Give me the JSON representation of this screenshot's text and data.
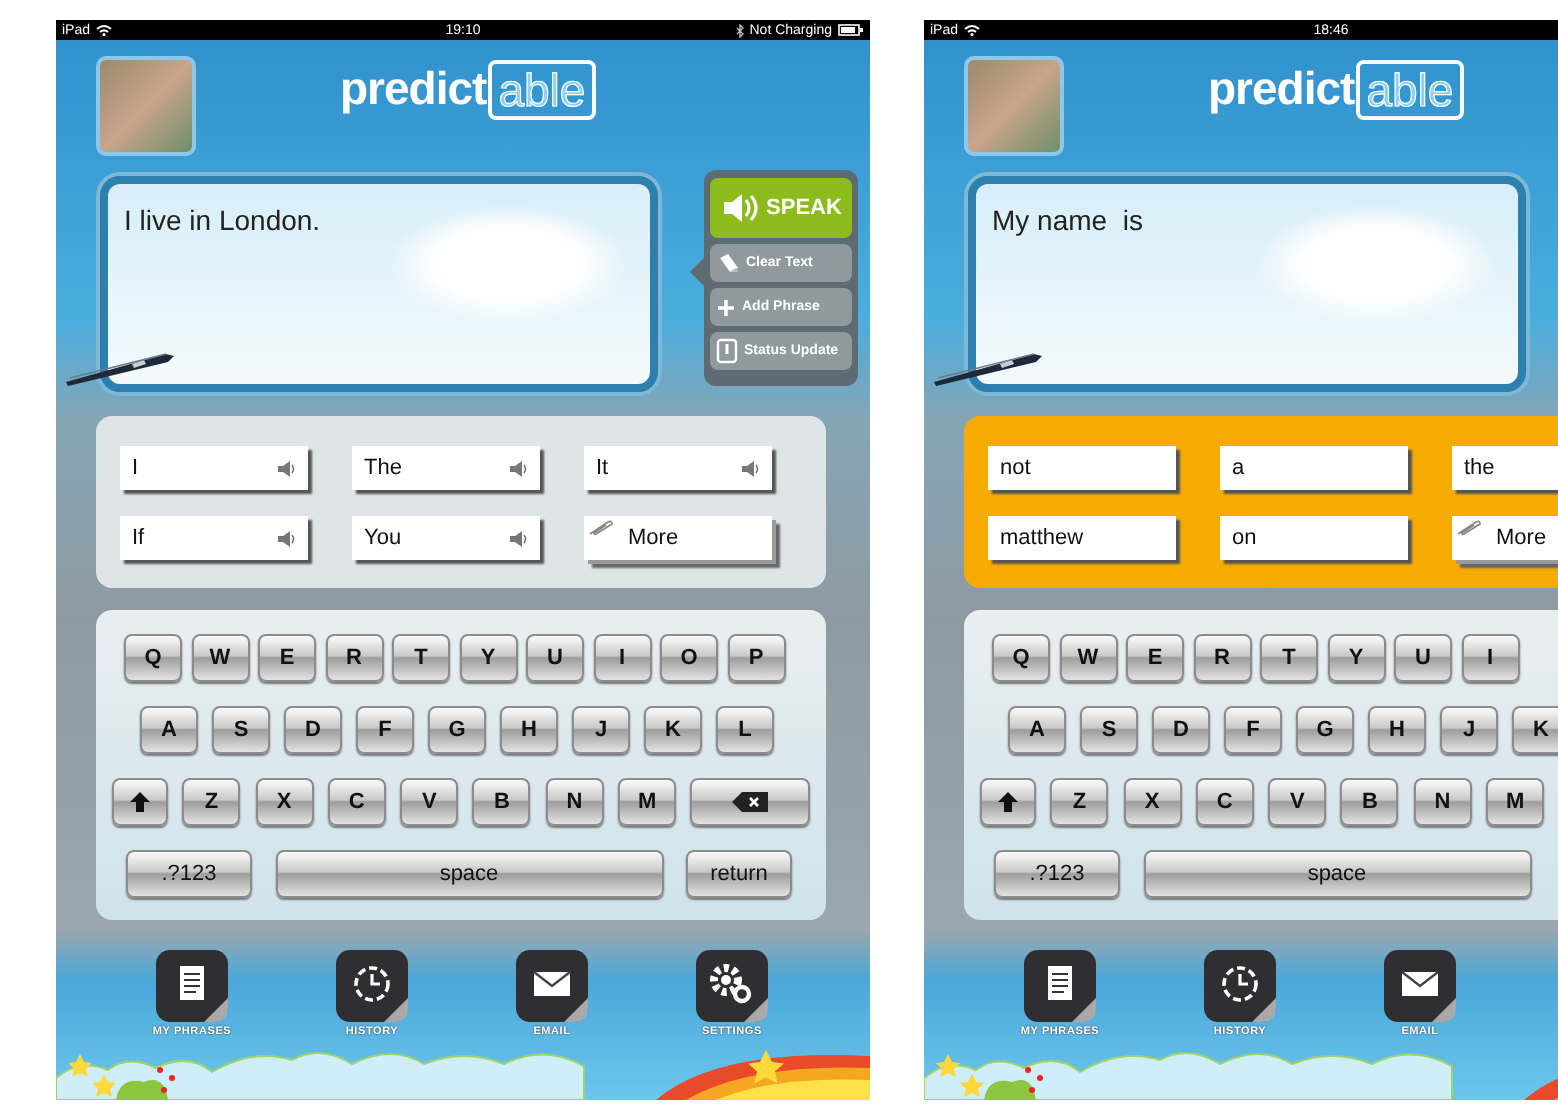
{
  "screens": [
    {
      "status_bar": {
        "carrier": "iPad",
        "time": "19:10",
        "charging": "Not Charging"
      },
      "logo": {
        "main": "predict",
        "accent": "able"
      },
      "message": "I live in London.",
      "actions": [
        {
          "kind": "speak",
          "label": "SPEAK"
        },
        {
          "kind": "clear",
          "label": "Clear Text"
        },
        {
          "kind": "add",
          "label": "Add Phrase"
        },
        {
          "kind": "status",
          "label": "Status Update"
        }
      ],
      "word_panel": {
        "highlighted": false,
        "words": [
          {
            "kind": "word",
            "text": "I",
            "speaker": true
          },
          {
            "kind": "word",
            "text": "The",
            "speaker": true
          },
          {
            "kind": "word",
            "text": "It",
            "speaker": true
          },
          {
            "kind": "word",
            "text": "If",
            "speaker": true
          },
          {
            "kind": "word",
            "text": "You",
            "speaker": true
          },
          {
            "kind": "more",
            "text": "More"
          }
        ]
      },
      "keyboard": [
        [
          {
            "kind": "letter",
            "label": "Q"
          },
          {
            "kind": "letter",
            "label": "W"
          },
          {
            "kind": "letter",
            "label": "E"
          },
          {
            "kind": "letter",
            "label": "R"
          },
          {
            "kind": "letter",
            "label": "T"
          },
          {
            "kind": "letter",
            "label": "Y"
          },
          {
            "kind": "letter",
            "label": "U"
          },
          {
            "kind": "letter",
            "label": "I"
          },
          {
            "kind": "letter",
            "label": "O"
          },
          {
            "kind": "letter",
            "label": "P"
          }
        ],
        [
          {
            "kind": "letter",
            "label": "A"
          },
          {
            "kind": "letter",
            "label": "S"
          },
          {
            "kind": "letter",
            "label": "D"
          },
          {
            "kind": "letter",
            "label": "F"
          },
          {
            "kind": "letter",
            "label": "G"
          },
          {
            "kind": "letter",
            "label": "H"
          },
          {
            "kind": "letter",
            "label": "J"
          },
          {
            "kind": "letter",
            "label": "K"
          },
          {
            "kind": "letter",
            "label": "L"
          }
        ],
        [
          {
            "kind": "shift"
          },
          {
            "kind": "letter",
            "label": "Z"
          },
          {
            "kind": "letter",
            "label": "X"
          },
          {
            "kind": "letter",
            "label": "C"
          },
          {
            "kind": "letter",
            "label": "V"
          },
          {
            "kind": "letter",
            "label": "B"
          },
          {
            "kind": "letter",
            "label": "N"
          },
          {
            "kind": "letter",
            "label": "M"
          },
          {
            "kind": "backspace"
          }
        ],
        [
          {
            "kind": "symbols",
            "label": ".?123"
          },
          {
            "kind": "space",
            "label": "space"
          },
          {
            "kind": "return",
            "label": "return"
          }
        ]
      ],
      "dock": [
        {
          "kind": "phrases",
          "label": "MY PHRASES"
        },
        {
          "kind": "history",
          "label": "HISTORY"
        },
        {
          "kind": "email",
          "label": "EMAIL"
        },
        {
          "kind": "settings",
          "label": "SETTINGS"
        }
      ]
    },
    {
      "status_bar": {
        "carrier": "iPad",
        "time": "18:46"
      },
      "logo": {
        "main": "predict",
        "accent": "able"
      },
      "message": "My name  is",
      "word_panel": {
        "highlighted": true,
        "words": [
          {
            "kind": "word",
            "text": "not"
          },
          {
            "kind": "word",
            "text": "a"
          },
          {
            "kind": "word",
            "text": "the"
          },
          {
            "kind": "word",
            "text": "matthew"
          },
          {
            "kind": "word",
            "text": "on"
          },
          {
            "kind": "more",
            "text": "More"
          }
        ]
      },
      "keyboard": [
        [
          {
            "kind": "letter",
            "label": "Q"
          },
          {
            "kind": "letter",
            "label": "W"
          },
          {
            "kind": "letter",
            "label": "E"
          },
          {
            "kind": "letter",
            "label": "R"
          },
          {
            "kind": "letter",
            "label": "T"
          },
          {
            "kind": "letter",
            "label": "Y"
          },
          {
            "kind": "letter",
            "label": "U"
          },
          {
            "kind": "letter",
            "label": "I"
          }
        ],
        [
          {
            "kind": "letter",
            "label": "A"
          },
          {
            "kind": "letter",
            "label": "S"
          },
          {
            "kind": "letter",
            "label": "D"
          },
          {
            "kind": "letter",
            "label": "F"
          },
          {
            "kind": "letter",
            "label": "G"
          },
          {
            "kind": "letter",
            "label": "H"
          },
          {
            "kind": "letter",
            "label": "J"
          },
          {
            "kind": "letter",
            "label": "K"
          }
        ],
        [
          {
            "kind": "shift"
          },
          {
            "kind": "letter",
            "label": "Z"
          },
          {
            "kind": "letter",
            "label": "X"
          },
          {
            "kind": "letter",
            "label": "C"
          },
          {
            "kind": "letter",
            "label": "V"
          },
          {
            "kind": "letter",
            "label": "B"
          },
          {
            "kind": "letter",
            "label": "N"
          },
          {
            "kind": "letter",
            "label": "M"
          }
        ],
        [
          {
            "kind": "symbols",
            "label": ".?123"
          },
          {
            "kind": "space",
            "label": "space"
          }
        ]
      ],
      "dock": [
        {
          "kind": "phrases",
          "label": "MY PHRASES"
        },
        {
          "kind": "history",
          "label": "HISTORY"
        },
        {
          "kind": "email",
          "label": "EMAIL"
        }
      ]
    }
  ]
}
